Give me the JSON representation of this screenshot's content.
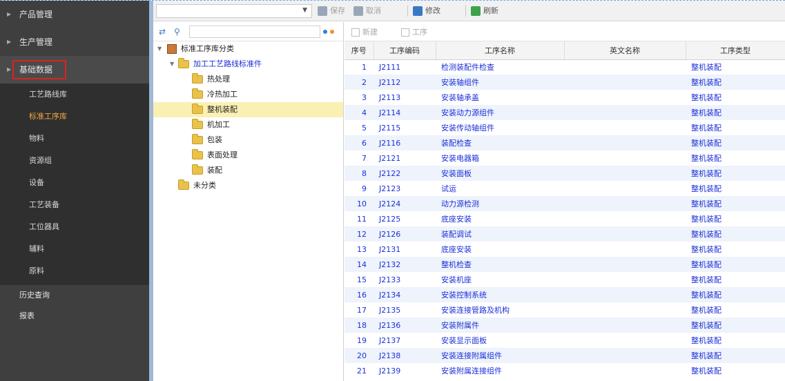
{
  "nav": {
    "groups_before": [
      {
        "label": "产品管理"
      },
      {
        "label": "生产管理"
      }
    ],
    "expanded_group": {
      "label": "基础数据",
      "items": [
        {
          "label": "工艺路线库",
          "active": false
        },
        {
          "label": "标准工序库",
          "active": true
        },
        {
          "label": "物料",
          "active": false
        },
        {
          "label": "资源组",
          "active": false
        },
        {
          "label": "设备",
          "active": false
        },
        {
          "label": "工艺装备",
          "active": false
        },
        {
          "label": "工位器具",
          "active": false
        },
        {
          "label": "辅料",
          "active": false
        },
        {
          "label": "原料",
          "active": false
        }
      ]
    },
    "groups_after": [
      {
        "label": "历史查询"
      },
      {
        "label": "报表"
      }
    ]
  },
  "toolbar": {
    "buttons": [
      {
        "label": "保存",
        "enabled": false,
        "icon": "save-icon"
      },
      {
        "label": "取消",
        "enabled": false,
        "icon": "undo-icon"
      },
      {
        "label": "修改",
        "enabled": true,
        "icon": "edit-icon"
      },
      {
        "label": "刷新",
        "enabled": true,
        "icon": "refresh-icon"
      }
    ]
  },
  "tree": {
    "root": "标准工序库分类",
    "category": "加工工艺路线标准件",
    "children": [
      "热处理",
      "冷热加工",
      "整机装配",
      "机加工",
      "包装",
      "表面处理",
      "装配"
    ],
    "selected_index": 2,
    "other": "未分类"
  },
  "grid": {
    "toolbar": {
      "new_label": "新建",
      "delete_label": "工序"
    },
    "columns": [
      "序号",
      "工序编码",
      "工序名称",
      "英文名称",
      "工序类型"
    ],
    "rows": [
      [
        "1",
        "J2111",
        "检测装配件检查",
        "",
        "整机装配"
      ],
      [
        "2",
        "J2112",
        "安装轴组件",
        "",
        "整机装配"
      ],
      [
        "3",
        "J2113",
        "安装轴承盖",
        "",
        "整机装配"
      ],
      [
        "4",
        "J2114",
        "安装动力源组件",
        "",
        "整机装配"
      ],
      [
        "5",
        "J2115",
        "安装传动轴组件",
        "",
        "整机装配"
      ],
      [
        "6",
        "J2116",
        "装配检查",
        "",
        "整机装配"
      ],
      [
        "7",
        "J2121",
        "安装电器箱",
        "",
        "整机装配"
      ],
      [
        "8",
        "J2122",
        "安装面板",
        "",
        "整机装配"
      ],
      [
        "9",
        "J2123",
        "试运",
        "",
        "整机装配"
      ],
      [
        "10",
        "J2124",
        "动力源检测",
        "",
        "整机装配"
      ],
      [
        "11",
        "J2125",
        "底座安装",
        "",
        "整机装配"
      ],
      [
        "12",
        "J2126",
        "装配调试",
        "",
        "整机装配"
      ],
      [
        "13",
        "J2131",
        "底座安装",
        "",
        "整机装配"
      ],
      [
        "14",
        "J2132",
        "整机检查",
        "",
        "整机装配"
      ],
      [
        "15",
        "J2133",
        "安装机座",
        "",
        "整机装配"
      ],
      [
        "16",
        "J2134",
        "安装控制系统",
        "",
        "整机装配"
      ],
      [
        "17",
        "J2135",
        "安装连接管路及机构",
        "",
        "整机装配"
      ],
      [
        "18",
        "J2136",
        "安装附属件",
        "",
        "整机装配"
      ],
      [
        "19",
        "J2137",
        "安装显示面板",
        "",
        "整机装配"
      ],
      [
        "20",
        "J2138",
        "安装连接附属组件",
        "",
        "整机装配"
      ],
      [
        "21",
        "J2139",
        "安装附属连接组件",
        "",
        "整机装配"
      ]
    ]
  },
  "colors": {
    "nav_bg": "#3f3f3f",
    "nav_sub_bg": "#2f2f2f",
    "nav_active": "#f2a640",
    "highlight_outline": "#e02020",
    "link_text": "#1a2fd6",
    "selected_node": "#fbf0b4",
    "row_alt": "#eef3fc"
  }
}
